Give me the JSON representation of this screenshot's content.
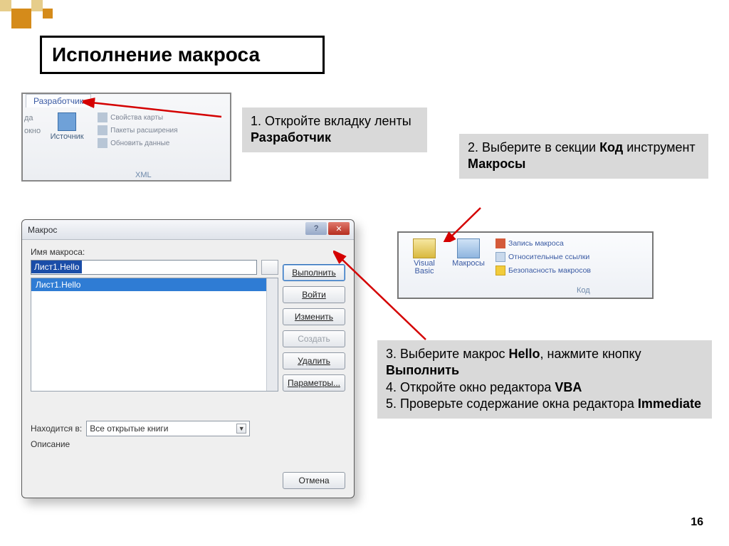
{
  "title": "Исполнение макроса",
  "ribbon": {
    "tab": "Разработчик",
    "source_btn": "Источник",
    "props": "Свойства карты",
    "packs": "Пакеты расширения",
    "refresh": "Обновить данные",
    "group": "XML",
    "left_cut1": "да",
    "left_cut2": "окно"
  },
  "callout1_pre": "1. Откройте вкладку ленты ",
  "callout1_bold": "Разработчик",
  "callout2_pre": "2. Выберите в секции ",
  "callout2_b1": "Код",
  "callout2_mid": " инструмент ",
  "callout2_b2": "Макросы",
  "dialog": {
    "title": "Макрос",
    "name_label": "Имя макроса:",
    "name_value": "Лист1.Hello",
    "list_item": "Лист1.Hello",
    "location_label": "Находится в:",
    "location_value": "Все открытые книги",
    "desc_label": "Описание",
    "btn_run": "Выполнить",
    "btn_step": "Войти",
    "btn_edit": "Изменить",
    "btn_create": "Создать",
    "btn_delete": "Удалить",
    "btn_params": "Параметры...",
    "btn_cancel": "Отмена",
    "help": "?",
    "close": "✕"
  },
  "code_group": {
    "vb": "Visual Basic",
    "macros": "Макросы",
    "record": "Запись макроса",
    "relative": "Относительные ссылки",
    "security": "Безопасность макросов",
    "group": "Код"
  },
  "callout3_l1a": "3. Выберите макрос ",
  "callout3_l1b": "Hello",
  "callout3_l1c": ", нажмите кнопку ",
  "callout3_l1d": "Выполнить",
  "callout3_l2a": "4. Откройте окно редактора ",
  "callout3_l2b": "VBA",
  "callout3_l3a": "5. Проверьте  содержание окна редактора ",
  "callout3_l3b": "Immediate",
  "page_number": "16"
}
